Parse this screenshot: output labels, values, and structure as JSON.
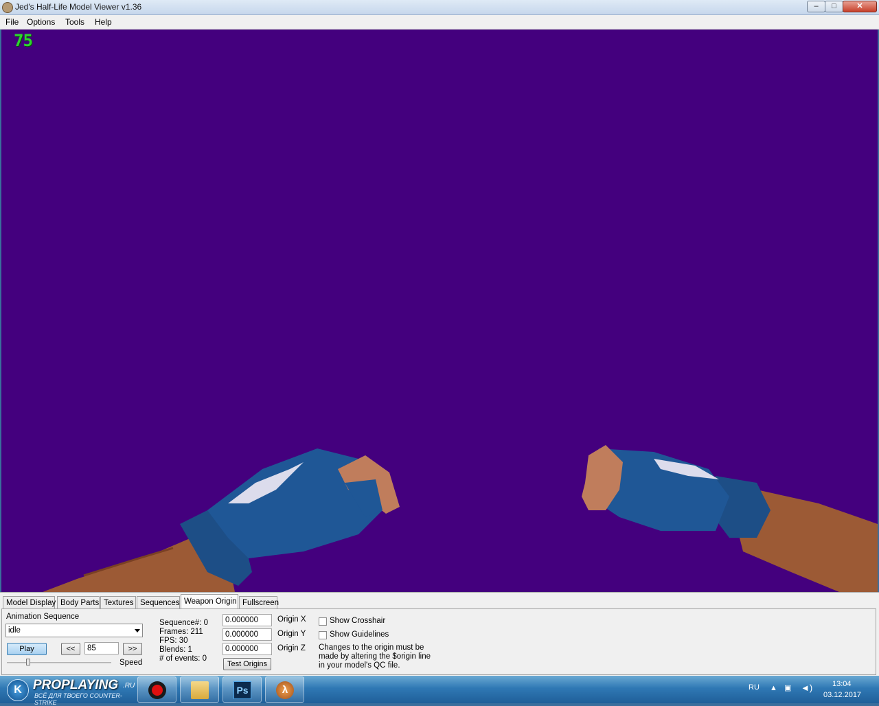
{
  "window": {
    "title": "Jed's Half-Life Model Viewer v1.36",
    "controls": {
      "minimize": "–",
      "maximize": "□",
      "close": "✕"
    }
  },
  "menu": [
    "File",
    "Options",
    "Tools",
    "Help"
  ],
  "viewport": {
    "background": "#44007e",
    "fps_counter": "75",
    "model": "blue gloved hands (viewmodel)"
  },
  "tabs": [
    "Model Display",
    "Body Parts",
    "Textures",
    "Sequences",
    "Weapon Origin",
    "Fullscreen"
  ],
  "active_tab": "Weapon Origin",
  "animation": {
    "label": "Animation Sequence",
    "selected": "idle",
    "play_label": "Play",
    "prev_label": "<<",
    "next_label": ">>",
    "frame_value": "85",
    "speed_label": "Speed",
    "speed_level": 0.2
  },
  "sequence_info": {
    "sequence": "Sequence#: 0",
    "frames": "Frames: 211",
    "fps": "FPS: 30",
    "blends": "Blends: 1",
    "events": "# of events: 0"
  },
  "origin": {
    "x_value": "0.000000",
    "x_label": "Origin X",
    "y_value": "0.000000",
    "y_label": "Origin Y",
    "z_value": "0.000000",
    "z_label": "Origin Z",
    "test_button": "Test Origins"
  },
  "options": {
    "show_crosshair": "Show Crosshair",
    "show_guidelines": "Show Guidelines",
    "note_line1": "Changes to the origin must be",
    "note_line2": "made by altering the $origin line",
    "note_line3": "in your model's QC file."
  },
  "taskbar": {
    "brand_name": "PROPLAYING",
    "brand_domain": ".RU",
    "brand_tagline": "ВСЁ ДЛЯ ТВОЕГО COUNTER-STRIKE",
    "apps": [
      "yandex-browser-icon",
      "record-icon",
      "file-explorer-icon",
      "photoshop-icon",
      "half-life-icon"
    ],
    "language": "RU",
    "time": "13:04",
    "date": "03.12.2017"
  }
}
